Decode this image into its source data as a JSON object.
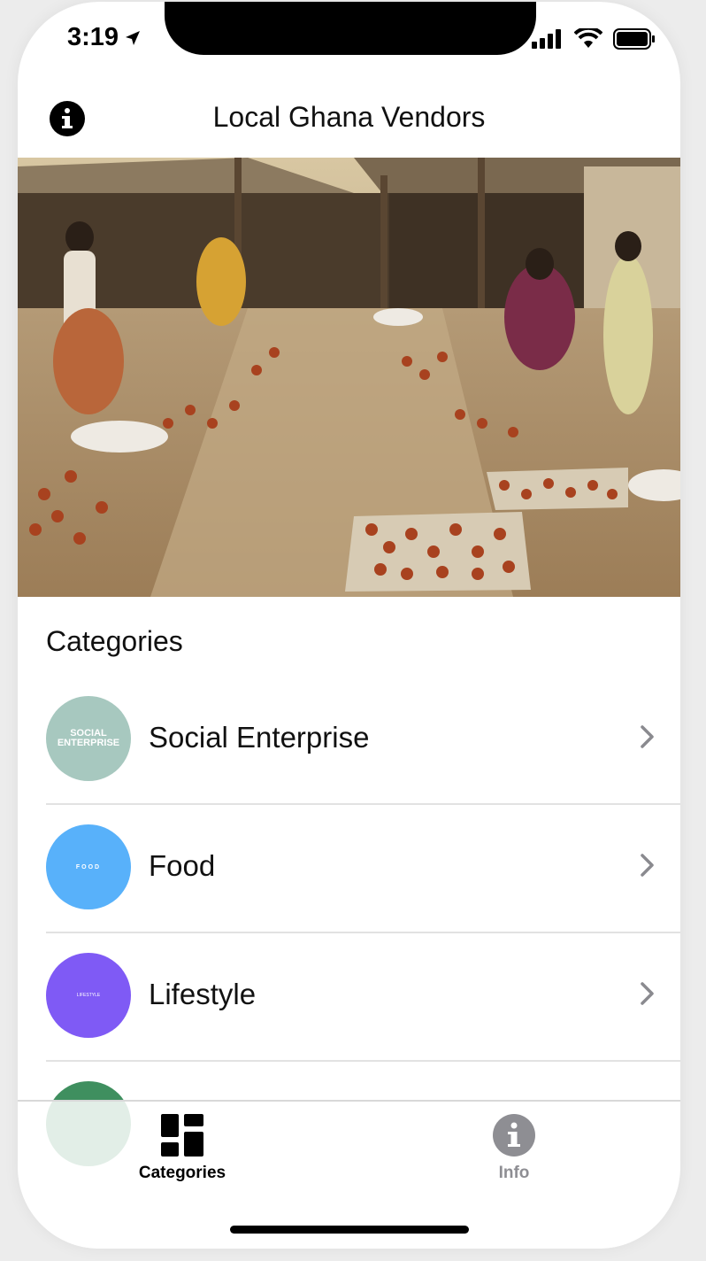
{
  "status": {
    "time": "3:19"
  },
  "nav": {
    "title": "Local Ghana Vendors",
    "info_icon": "info-icon"
  },
  "section": {
    "title": "Categories"
  },
  "categories": [
    {
      "label": "Social Enterprise",
      "badge": "SOCIAL ENTERPRISE",
      "color": "#a7c8bf"
    },
    {
      "label": "Food",
      "badge": "FOOD",
      "color": "#58b1fa"
    },
    {
      "label": "Lifestyle",
      "badge": "LIFESTYLE",
      "color": "#7f5af5"
    },
    {
      "label": "",
      "badge": "",
      "color": "#3f8f5f"
    }
  ],
  "tabs": [
    {
      "label": "Categories",
      "icon": "dashboard-icon",
      "active": true
    },
    {
      "label": "Info",
      "icon": "info-icon",
      "active": false
    }
  ],
  "colors": {
    "active_tab": "#000000",
    "inactive_tab": "#8e8e93"
  }
}
